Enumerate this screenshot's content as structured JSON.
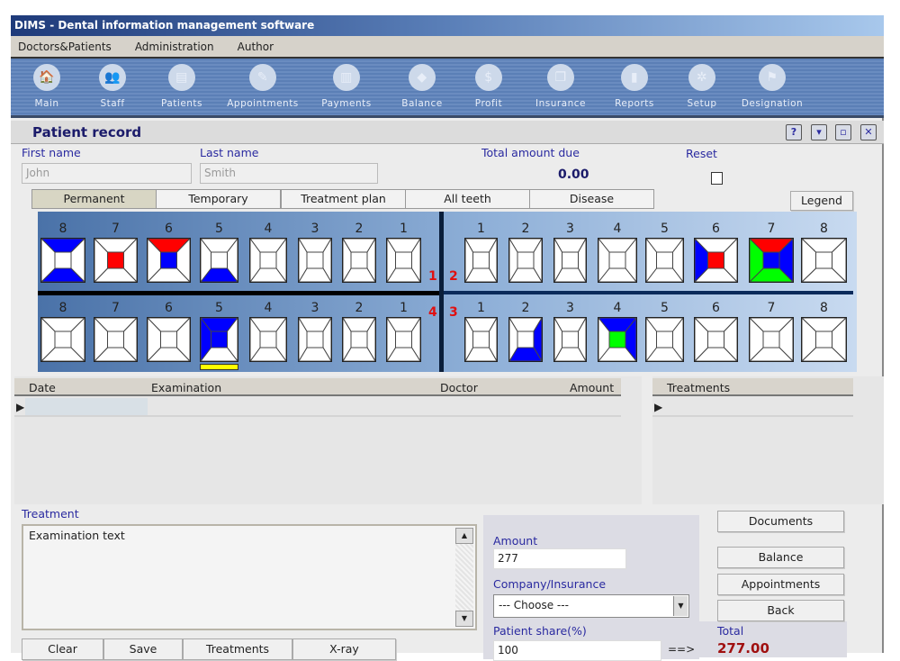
{
  "window": {
    "title": "DIMS - Dental information management software"
  },
  "menu": [
    "Doctors&Patients",
    "Administration",
    "Author"
  ],
  "toolbar": [
    {
      "label": "Main",
      "icon": "home-icon",
      "glyph": "🏠"
    },
    {
      "label": "Staff",
      "icon": "staff-icon",
      "glyph": "👥"
    },
    {
      "label": "Patients",
      "icon": "patients-icon",
      "glyph": "▤"
    },
    {
      "label": "Appointments",
      "icon": "appointments-icon",
      "glyph": "✎"
    },
    {
      "label": "Payments",
      "icon": "payments-icon",
      "glyph": "▥"
    },
    {
      "label": "Balance",
      "icon": "balance-icon",
      "glyph": "◆"
    },
    {
      "label": "Profit",
      "icon": "profit-icon",
      "glyph": "$"
    },
    {
      "label": "Insurance",
      "icon": "insurance-icon",
      "glyph": "❐"
    },
    {
      "label": "Reports",
      "icon": "reports-icon",
      "glyph": "▮"
    },
    {
      "label": "Setup",
      "icon": "setup-icon",
      "glyph": "✲"
    },
    {
      "label": "Designation",
      "icon": "designation-icon",
      "glyph": "⚑"
    }
  ],
  "panel": {
    "title": "Patient record",
    "buttons": {
      "help": "?",
      "minimize": "▾",
      "maximize": "▫",
      "close": "✕"
    }
  },
  "patient": {
    "first_name_label": "First name",
    "first_name": "John",
    "last_name_label": "Last name",
    "last_name": "Smith",
    "total_due_label": "Total amount due",
    "total_due": "0.00",
    "reset_label": "Reset",
    "reset_checked": false
  },
  "tabs": [
    {
      "label": "Permanent",
      "active": true
    },
    {
      "label": "Temporary"
    },
    {
      "label": "Treatment plan"
    },
    {
      "label": "All teeth"
    },
    {
      "label": "Disease"
    }
  ],
  "legend_button": "Legend",
  "colors": {
    "blue": "#0000ff",
    "red": "#ff0000",
    "green": "#00ff00",
    "yellow": "#ffff00",
    "label_blue": "#2a2aa0",
    "total_red": "#a01010"
  },
  "quadrants": {
    "q1": {
      "label": "1",
      "teeth": [
        {
          "n": "8",
          "t": "blue",
          "b": "blue"
        },
        {
          "n": "7",
          "c": "red"
        },
        {
          "n": "6",
          "t": "red",
          "c": "blue"
        },
        {
          "n": "5",
          "b": "blue"
        },
        {
          "n": "4"
        },
        {
          "n": "3"
        },
        {
          "n": "2"
        },
        {
          "n": "1"
        }
      ]
    },
    "q2": {
      "label": "2",
      "teeth": [
        {
          "n": "1"
        },
        {
          "n": "2"
        },
        {
          "n": "3"
        },
        {
          "n": "4"
        },
        {
          "n": "5"
        },
        {
          "n": "6",
          "l": "blue",
          "c": "red"
        },
        {
          "n": "7",
          "t": "red",
          "l": "green",
          "b": "green",
          "r": "blue",
          "c": "blue"
        },
        {
          "n": "8"
        }
      ]
    },
    "q4": {
      "label": "4",
      "teeth": [
        {
          "n": "8"
        },
        {
          "n": "7"
        },
        {
          "n": "6"
        },
        {
          "n": "5",
          "t": "blue",
          "l": "blue",
          "c": "blue",
          "bar": "yellow"
        },
        {
          "n": "4"
        },
        {
          "n": "3"
        },
        {
          "n": "2"
        },
        {
          "n": "1"
        }
      ]
    },
    "q3": {
      "label": "3",
      "teeth": [
        {
          "n": "1"
        },
        {
          "n": "2",
          "r": "blue",
          "b": "blue"
        },
        {
          "n": "3"
        },
        {
          "n": "4",
          "t": "blue",
          "r": "blue",
          "c": "green"
        },
        {
          "n": "5"
        },
        {
          "n": "6"
        },
        {
          "n": "7"
        },
        {
          "n": "8"
        }
      ]
    }
  },
  "exam_table": {
    "columns": [
      "Date",
      "Examination",
      "Doctor",
      "Amount"
    ],
    "rows": []
  },
  "treat_table": {
    "columns": [
      "Treatments"
    ],
    "rows": []
  },
  "treatment": {
    "label": "Treatment",
    "text": "Examination text"
  },
  "bottom_buttons": [
    "Clear",
    "Save",
    "Treatments",
    "X-ray"
  ],
  "payment": {
    "amount_label": "Amount",
    "amount": "277",
    "insurance_label": "Company/Insurance",
    "insurance": "--- Choose ---",
    "share_label": "Patient share(%)",
    "share": "100",
    "arrow": "==>",
    "total_label": "Total",
    "total": "277.00"
  },
  "side_buttons": [
    "Documents",
    "Balance",
    "Appointments",
    "Back"
  ]
}
